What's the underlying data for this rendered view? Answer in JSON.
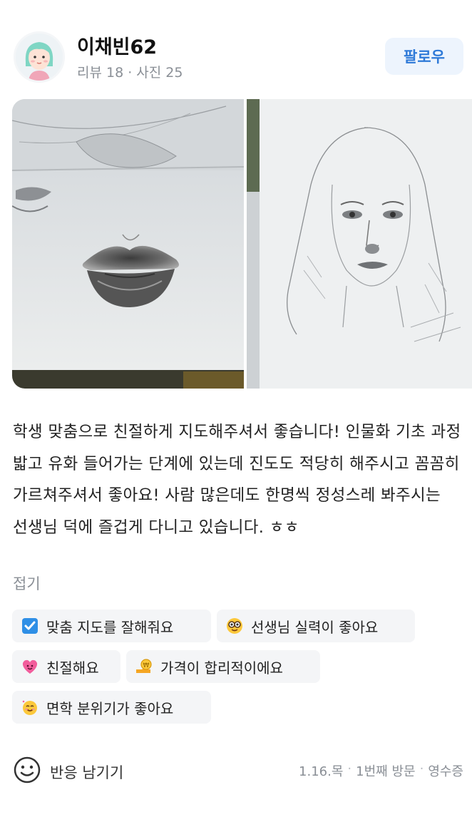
{
  "user": {
    "name": "이채빈62",
    "stats": "리뷰 18 · 사진 25",
    "follow_label": "팔로우"
  },
  "photos": [
    {
      "icon": "lips-sketch-photo"
    },
    {
      "icon": "portrait-sketch-photo"
    }
  ],
  "review": {
    "text": "학생 맞춤으로 친절하게 지도해주셔서 좋습니다! 인물화 기초 과정 밟고 유화 들어가는 단계에 있는데 진도도 적당히 해주시고 꼼꼼히 가르쳐주셔서 좋아요! 사람 많은데도 한명씩 정성스레 봐주시는 선생님 덕에 즐겁게 다니고 있습니다. ㅎㅎ",
    "collapse_label": "접기"
  },
  "tags": [
    {
      "label": "맞춤 지도를 잘해줘요",
      "icon": "check-box-icon"
    },
    {
      "label": "선생님 실력이 좋아요",
      "icon": "nerd-face-icon"
    },
    {
      "label": "친절해요",
      "icon": "heart-face-icon"
    },
    {
      "label": "가격이 합리적이에요",
      "icon": "coin-hand-icon"
    },
    {
      "label": "면학 분위기가 좋아요",
      "icon": "smiling-face-icon"
    }
  ],
  "footer": {
    "react_label": "반응 남기기",
    "date": "1.16.목",
    "visit": "1번째 방문",
    "receipt": "영수증"
  },
  "colors": {
    "accent": "#2f7ad8",
    "follow_bg": "#edf4fd",
    "tag_bg": "#f4f5f7",
    "muted": "#8a8f96"
  }
}
